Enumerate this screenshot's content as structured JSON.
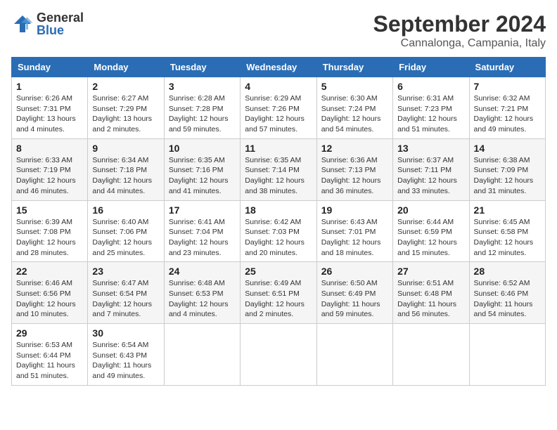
{
  "logo": {
    "general": "General",
    "blue": "Blue"
  },
  "header": {
    "month": "September 2024",
    "location": "Cannalonga, Campania, Italy"
  },
  "weekdays": [
    "Sunday",
    "Monday",
    "Tuesday",
    "Wednesday",
    "Thursday",
    "Friday",
    "Saturday"
  ],
  "weeks": [
    [
      {
        "day": "1",
        "info": "Sunrise: 6:26 AM\nSunset: 7:31 PM\nDaylight: 13 hours\nand 4 minutes."
      },
      {
        "day": "2",
        "info": "Sunrise: 6:27 AM\nSunset: 7:29 PM\nDaylight: 13 hours\nand 2 minutes."
      },
      {
        "day": "3",
        "info": "Sunrise: 6:28 AM\nSunset: 7:28 PM\nDaylight: 12 hours\nand 59 minutes."
      },
      {
        "day": "4",
        "info": "Sunrise: 6:29 AM\nSunset: 7:26 PM\nDaylight: 12 hours\nand 57 minutes."
      },
      {
        "day": "5",
        "info": "Sunrise: 6:30 AM\nSunset: 7:24 PM\nDaylight: 12 hours\nand 54 minutes."
      },
      {
        "day": "6",
        "info": "Sunrise: 6:31 AM\nSunset: 7:23 PM\nDaylight: 12 hours\nand 51 minutes."
      },
      {
        "day": "7",
        "info": "Sunrise: 6:32 AM\nSunset: 7:21 PM\nDaylight: 12 hours\nand 49 minutes."
      }
    ],
    [
      {
        "day": "8",
        "info": "Sunrise: 6:33 AM\nSunset: 7:19 PM\nDaylight: 12 hours\nand 46 minutes."
      },
      {
        "day": "9",
        "info": "Sunrise: 6:34 AM\nSunset: 7:18 PM\nDaylight: 12 hours\nand 44 minutes."
      },
      {
        "day": "10",
        "info": "Sunrise: 6:35 AM\nSunset: 7:16 PM\nDaylight: 12 hours\nand 41 minutes."
      },
      {
        "day": "11",
        "info": "Sunrise: 6:35 AM\nSunset: 7:14 PM\nDaylight: 12 hours\nand 38 minutes."
      },
      {
        "day": "12",
        "info": "Sunrise: 6:36 AM\nSunset: 7:13 PM\nDaylight: 12 hours\nand 36 minutes."
      },
      {
        "day": "13",
        "info": "Sunrise: 6:37 AM\nSunset: 7:11 PM\nDaylight: 12 hours\nand 33 minutes."
      },
      {
        "day": "14",
        "info": "Sunrise: 6:38 AM\nSunset: 7:09 PM\nDaylight: 12 hours\nand 31 minutes."
      }
    ],
    [
      {
        "day": "15",
        "info": "Sunrise: 6:39 AM\nSunset: 7:08 PM\nDaylight: 12 hours\nand 28 minutes."
      },
      {
        "day": "16",
        "info": "Sunrise: 6:40 AM\nSunset: 7:06 PM\nDaylight: 12 hours\nand 25 minutes."
      },
      {
        "day": "17",
        "info": "Sunrise: 6:41 AM\nSunset: 7:04 PM\nDaylight: 12 hours\nand 23 minutes."
      },
      {
        "day": "18",
        "info": "Sunrise: 6:42 AM\nSunset: 7:03 PM\nDaylight: 12 hours\nand 20 minutes."
      },
      {
        "day": "19",
        "info": "Sunrise: 6:43 AM\nSunset: 7:01 PM\nDaylight: 12 hours\nand 18 minutes."
      },
      {
        "day": "20",
        "info": "Sunrise: 6:44 AM\nSunset: 6:59 PM\nDaylight: 12 hours\nand 15 minutes."
      },
      {
        "day": "21",
        "info": "Sunrise: 6:45 AM\nSunset: 6:58 PM\nDaylight: 12 hours\nand 12 minutes."
      }
    ],
    [
      {
        "day": "22",
        "info": "Sunrise: 6:46 AM\nSunset: 6:56 PM\nDaylight: 12 hours\nand 10 minutes."
      },
      {
        "day": "23",
        "info": "Sunrise: 6:47 AM\nSunset: 6:54 PM\nDaylight: 12 hours\nand 7 minutes."
      },
      {
        "day": "24",
        "info": "Sunrise: 6:48 AM\nSunset: 6:53 PM\nDaylight: 12 hours\nand 4 minutes."
      },
      {
        "day": "25",
        "info": "Sunrise: 6:49 AM\nSunset: 6:51 PM\nDaylight: 12 hours\nand 2 minutes."
      },
      {
        "day": "26",
        "info": "Sunrise: 6:50 AM\nSunset: 6:49 PM\nDaylight: 11 hours\nand 59 minutes."
      },
      {
        "day": "27",
        "info": "Sunrise: 6:51 AM\nSunset: 6:48 PM\nDaylight: 11 hours\nand 56 minutes."
      },
      {
        "day": "28",
        "info": "Sunrise: 6:52 AM\nSunset: 6:46 PM\nDaylight: 11 hours\nand 54 minutes."
      }
    ],
    [
      {
        "day": "29",
        "info": "Sunrise: 6:53 AM\nSunset: 6:44 PM\nDaylight: 11 hours\nand 51 minutes."
      },
      {
        "day": "30",
        "info": "Sunrise: 6:54 AM\nSunset: 6:43 PM\nDaylight: 11 hours\nand 49 minutes."
      },
      null,
      null,
      null,
      null,
      null
    ]
  ]
}
